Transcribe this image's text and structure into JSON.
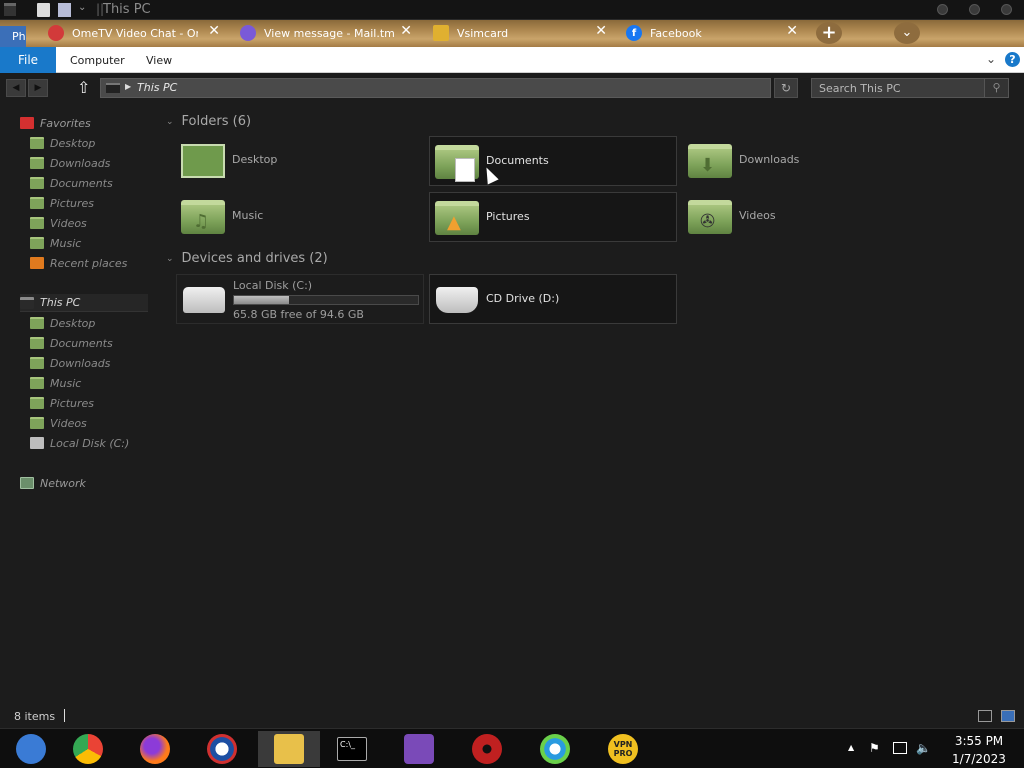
{
  "window": {
    "title": "This PC"
  },
  "titlebar": {
    "sep": "||"
  },
  "browser_tabs": {
    "corner_label": "Ph",
    "tabs": [
      {
        "label": "OmeTV Video Chat - Onl",
        "icon": "ometv-icon",
        "color": "#d23a3a"
      },
      {
        "label": "View message - Mail.tm",
        "icon": "mail-tm-icon",
        "color": "#7a5ad8"
      },
      {
        "label": "Vsimcard",
        "icon": "vsimcard-icon",
        "color": "#e0b030"
      },
      {
        "label": "Facebook",
        "icon": "facebook-icon",
        "color": "#1877f2"
      }
    ],
    "close_glyph": "✕",
    "new_tab_glyph": "+",
    "menu_glyph": "⌄"
  },
  "ribbon": {
    "file_label": "File",
    "tabs": [
      "Computer",
      "View"
    ],
    "collapse_glyph": "⌄",
    "help_glyph": "?"
  },
  "address": {
    "back_glyph": "◀",
    "forward_glyph": "▶",
    "up_glyph": "⇧",
    "crumb_arrow": "▶",
    "path": "This PC",
    "refresh_glyph": "↻",
    "search_placeholder": "Search This PC",
    "search_glyph": "⚲"
  },
  "navpane": {
    "favorites": {
      "label": "Favorites",
      "items": [
        "Desktop",
        "Downloads",
        "Documents",
        "Pictures",
        "Videos",
        "Music",
        "Recent places"
      ]
    },
    "this_pc": {
      "label": "This PC",
      "items": [
        "Desktop",
        "Documents",
        "Downloads",
        "Music",
        "Pictures",
        "Videos",
        "Local Disk (C:)"
      ]
    },
    "network": {
      "label": "Network"
    }
  },
  "content": {
    "folders_header": "Folders (6)",
    "folders": [
      "Desktop",
      "Documents",
      "Downloads",
      "Music",
      "Pictures",
      "Videos"
    ],
    "drives_header": "Devices and drives (2)",
    "drives": [
      {
        "name": "Local Disk (C:)",
        "free": "65.8 GB free of 94.6 GB",
        "used_fraction": 0.3
      },
      {
        "name": "CD Drive (D:)"
      }
    ],
    "chevron_glyph": "⌄"
  },
  "status": {
    "item_count": "8 items"
  },
  "taskbar": {
    "apps": [
      {
        "icon": "start-icon",
        "color": "#3a7bd5"
      },
      {
        "icon": "chrome-icon",
        "color": "#34a853"
      },
      {
        "icon": "firefox-icon",
        "color": "#ff7a1a"
      },
      {
        "icon": "obama-logo-icon",
        "color": "#1d4fa3"
      },
      {
        "icon": "file-explorer-icon",
        "color": "#e8c04a"
      },
      {
        "icon": "command-prompt-icon",
        "color": "#000000"
      },
      {
        "icon": "people-icon",
        "color": "#7a4ab8"
      },
      {
        "icon": "radiation-icon",
        "color": "#c02020"
      },
      {
        "icon": "browser-icon",
        "color": "#2a9be0"
      },
      {
        "icon": "vpn-pro-icon",
        "color": "#f0c020"
      }
    ],
    "cmd_label": "C:\\_",
    "vpn_label": "VPN PRO",
    "tray_up": "▲",
    "tray_flag": "⚑",
    "tray_volume": "🔈",
    "time": "3:55 PM",
    "date": "1/7/2023"
  }
}
